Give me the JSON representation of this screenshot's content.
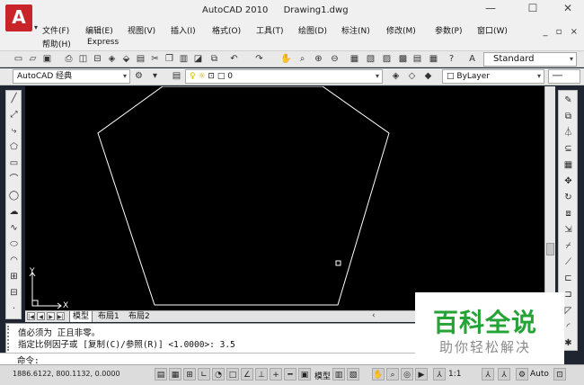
{
  "app": {
    "title": "AutoCAD 2010",
    "document": "Drawing1.dwg",
    "logo_letter": "A",
    "window_controls": [
      "—",
      "☐",
      "✕"
    ]
  },
  "menu": {
    "items": [
      "文件(F)",
      "编辑(E)",
      "视图(V)",
      "插入(I)",
      "格式(O)",
      "工具(T)",
      "绘图(D)",
      "标注(N)",
      "修改(M)",
      "参数(P)",
      "窗口(W)"
    ],
    "row2": [
      "帮助(H)",
      "Express"
    ],
    "mdi_controls": "_ ▫ ×"
  },
  "toolbar": {
    "text_style": "Standard"
  },
  "toolbar2": {
    "workspace": "AutoCAD 经典",
    "layer": "0",
    "color": "ByLayer"
  },
  "canvas": {
    "background": "#000000",
    "line_color": "#ffffff",
    "ucs_x": "X",
    "ucs_y": "Y"
  },
  "tabs": {
    "items": [
      "模型",
      "布局1",
      "布局2"
    ],
    "active": "模型"
  },
  "command": {
    "lines": [
      "值必须为 正且非零。",
      "指定比例因子或 [复制(C)/参照(R)] <1.0000>:  3.5"
    ],
    "prompt": "命令:"
  },
  "status": {
    "coordinates": "1886.6122, 800.1132, 0.0000",
    "model_label": "模型",
    "scale": "1:1",
    "auto_label": "Auto"
  },
  "watermark": {
    "title": "百科全说",
    "subtitle": "助你轻松解决",
    "color": "#25a336"
  }
}
